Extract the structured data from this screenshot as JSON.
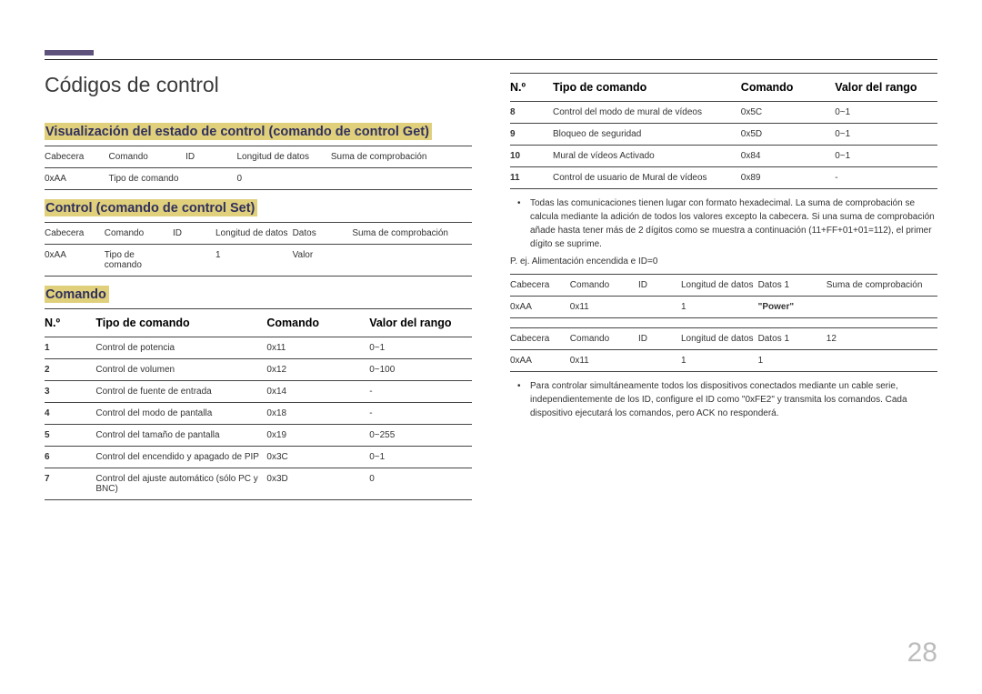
{
  "title": "Códigos de control",
  "section_get": "Visualización del estado de control (comando de control Get)",
  "get_table": {
    "headers": [
      "Cabecera",
      "Comando",
      "ID",
      "Longitud de datos",
      "Suma de comprobación"
    ],
    "row": [
      "0xAA",
      "Tipo de comando",
      "",
      "0",
      ""
    ]
  },
  "section_set": "Control (comando de control Set)",
  "set_table": {
    "headers": [
      "Cabecera",
      "Comando",
      "ID",
      "Longitud de datos",
      "Datos",
      "Suma de comprobación"
    ],
    "row": [
      "0xAA",
      "Tipo de comando",
      "",
      "1",
      "Valor",
      ""
    ]
  },
  "section_cmd": "Comando",
  "cmd_headers": [
    "N.º",
    "Tipo de comando",
    "Comando",
    "Valor del rango"
  ],
  "cmd_left": [
    {
      "n": "1",
      "t": "Control de potencia",
      "c": "0x11",
      "r": "0~1"
    },
    {
      "n": "2",
      "t": "Control de volumen",
      "c": "0x12",
      "r": "0~100"
    },
    {
      "n": "3",
      "t": "Control de fuente de entrada",
      "c": "0x14",
      "r": "-"
    },
    {
      "n": "4",
      "t": "Control del modo de pantalla",
      "c": "0x18",
      "r": "-"
    },
    {
      "n": "5",
      "t": "Control del tamaño de pantalla",
      "c": "0x19",
      "r": "0~255"
    },
    {
      "n": "6",
      "t": "Control del encendido y apagado de PIP",
      "c": "0x3C",
      "r": "0~1"
    },
    {
      "n": "7",
      "t": "Control del ajuste automático (sólo PC y BNC)",
      "c": "0x3D",
      "r": "0"
    }
  ],
  "cmd_right": [
    {
      "n": "8",
      "t": "Control del modo de mural de vídeos",
      "c": "0x5C",
      "r": "0~1"
    },
    {
      "n": "9",
      "t": "Bloqueo de seguridad",
      "c": "0x5D",
      "r": "0~1"
    },
    {
      "n": "10",
      "t": "Mural de vídeos Activado",
      "c": "0x84",
      "r": "0~1"
    },
    {
      "n": "11",
      "t": "Control de usuario de Mural de vídeos",
      "c": "0x89",
      "r": "-"
    }
  ],
  "note1": "Todas las comunicaciones tienen lugar con formato hexadecimal. La suma de comprobación se calcula mediante la adición de todos los valores excepto la cabecera. Si una suma de comprobación añade hasta tener más de 2 dígitos como se muestra a continuación (11+FF+01+01=112), el primer dígito se suprime.",
  "example_label": "P. ej. Alimentación encendida e ID=0",
  "ex_table_a": {
    "headers": [
      "Cabecera",
      "Comando",
      "ID",
      "Longitud de datos",
      "Datos 1",
      "Suma de comprobación"
    ],
    "row": [
      "0xAA",
      "0x11",
      "",
      "1",
      "\"Power\"",
      ""
    ]
  },
  "ex_table_b": {
    "headers": [
      "Cabecera",
      "Comando",
      "ID",
      "Longitud de datos",
      "Datos 1",
      "12"
    ],
    "row": [
      "0xAA",
      "0x11",
      "",
      "1",
      "1",
      ""
    ]
  },
  "note2": "Para controlar simultáneamente todos los dispositivos conectados mediante un cable serie, independientemente de los ID, configure el ID como \"0xFE2\" y transmita los comandos. Cada dispositivo ejecutará los comandos, pero ACK no responderá.",
  "page": "28"
}
